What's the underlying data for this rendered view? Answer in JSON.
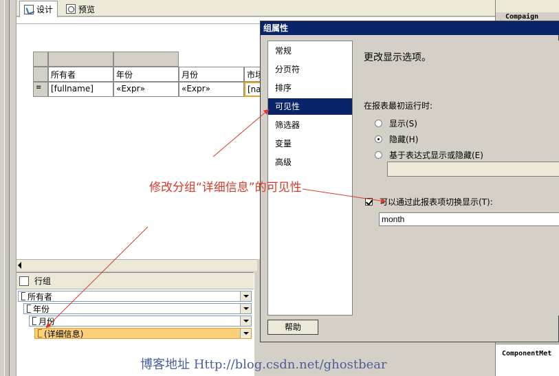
{
  "tabs": [
    {
      "label": "设计",
      "icon": "design-icon",
      "active": true
    },
    {
      "label": "预览",
      "icon": "preview-icon",
      "active": false
    }
  ],
  "tablix": {
    "headers": [
      "所有者",
      "年份",
      "月份",
      "市场"
    ],
    "cells": [
      "[fullname]",
      "«Expr»",
      "«Expr»",
      "[na"
    ]
  },
  "row_groups": {
    "title": "行组",
    "items": [
      {
        "label": "所有者",
        "level": 0
      },
      {
        "label": "年份",
        "level": 1
      },
      {
        "label": "月份",
        "level": 2
      },
      {
        "label": "(详细信息)",
        "level": 3,
        "selected": true
      }
    ]
  },
  "right_panel": {
    "top_item": "Compaign",
    "bottom_item": "ComponentMet"
  },
  "dialog": {
    "title": "组属性",
    "nav_items": [
      "常规",
      "分页符",
      "排序",
      "可见性",
      "筛选器",
      "变量",
      "高级"
    ],
    "active_nav": 3,
    "content_title": "更改显示选项。",
    "initial_label": "在报表最初运行时:",
    "options": [
      "显示(S)",
      "隐藏(H)",
      "基于表达式显示或隐藏(E)"
    ],
    "selected_option": 1,
    "toggle_label": "可以通过此报表项切换显示(T):",
    "toggle_checked": true,
    "toggle_value": "month",
    "help_label": "帮助"
  },
  "annotation": "修改分组“详细信息”的可见性",
  "watermark": "博客地址 Http://blog.csdn.net/ghostbear",
  "colors": {
    "title_bar": "#0a246a",
    "annotation": "#d83a2a",
    "selected_group": "#fcd07a",
    "watermark": "#4a5f9a"
  }
}
